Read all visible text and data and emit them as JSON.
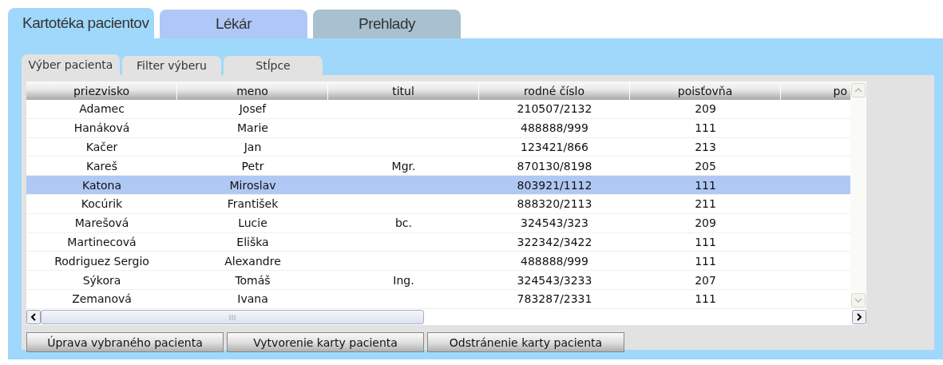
{
  "main_tabs": [
    {
      "label": "Kartotéka pacientov",
      "selected": true,
      "color": "#a0d8fc"
    },
    {
      "label": "Lékár",
      "selected": false,
      "color": "#b0c8f8"
    },
    {
      "label": "Prehlady",
      "selected": false,
      "color": "#a8c0d0"
    }
  ],
  "sub_tabs": [
    {
      "label": "Výber pacienta",
      "selected": true
    },
    {
      "label": "Filter výberu",
      "selected": false
    },
    {
      "label": "Stĺpce",
      "selected": false
    }
  ],
  "table": {
    "columns": [
      "priezvisko",
      "meno",
      "titul",
      "rodné číslo",
      "poisťovňa",
      "po"
    ],
    "rows": [
      {
        "cells": [
          "Adamec",
          "Josef",
          "",
          "210507/2132",
          "209",
          ""
        ],
        "selected": false
      },
      {
        "cells": [
          "Hanáková",
          "Marie",
          "",
          "488888/999",
          "111",
          ""
        ],
        "selected": false
      },
      {
        "cells": [
          "Kačer",
          "Jan",
          "",
          "123421/866",
          "213",
          ""
        ],
        "selected": false
      },
      {
        "cells": [
          "Kareš",
          "Petr",
          "Mgr.",
          "870130/8198",
          "205",
          ""
        ],
        "selected": false
      },
      {
        "cells": [
          "Katona",
          "Miroslav",
          "",
          "803921/1112",
          "111",
          ""
        ],
        "selected": true
      },
      {
        "cells": [
          "Kocúrik",
          "František",
          "",
          "888320/2113",
          "211",
          ""
        ],
        "selected": false
      },
      {
        "cells": [
          "Marešová",
          "Lucie",
          "bc.",
          "324543/323",
          "209",
          ""
        ],
        "selected": false
      },
      {
        "cells": [
          "Martinecová",
          "Eliška",
          "",
          "322342/3422",
          "111",
          ""
        ],
        "selected": false
      },
      {
        "cells": [
          "Rodriguez Sergio",
          "Alexandre",
          "",
          "488888/999",
          "111",
          ""
        ],
        "selected": false
      },
      {
        "cells": [
          "Sýkora",
          "Tomáš",
          "Ing.",
          "324543/3233",
          "207",
          ""
        ],
        "selected": false
      },
      {
        "cells": [
          "Zemanová",
          "Ivana",
          "",
          "783287/2331",
          "111",
          ""
        ],
        "selected": false
      }
    ]
  },
  "buttons": [
    "Úprava vybraného pacienta",
    "Vytvorenie karty pacienta",
    "Odstránenie karty pacienta"
  ]
}
